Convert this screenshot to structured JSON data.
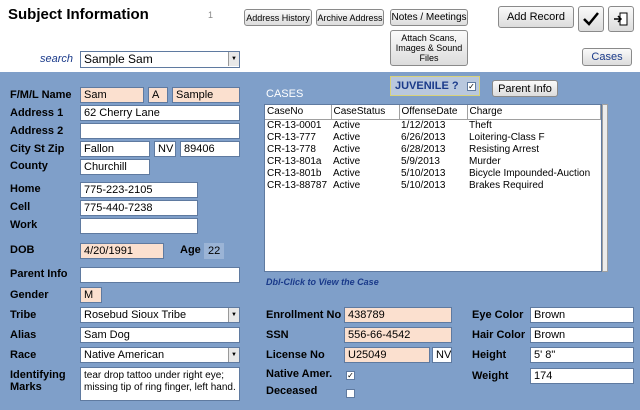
{
  "header": {
    "title": "Subject Information",
    "page_number": "1",
    "buttons": {
      "address_history": "Address History",
      "archive_address": "Archive Address",
      "notes_meetings": "Notes / Meetings",
      "add_record": "Add Record",
      "attach_files": "Attach Scans, Images & Sound Files",
      "cases": "Cases"
    },
    "search_label": "search",
    "search_value": "Sample Sam"
  },
  "subject": {
    "labels": {
      "name": "F/M/L Name",
      "address1": "Address 1",
      "address2": "Address 2",
      "city_st_zip": "City St Zip",
      "county": "County",
      "home": "Home",
      "cell": "Cell",
      "work": "Work",
      "dob": "DOB",
      "age": "Age",
      "parent_info": "Parent Info",
      "gender": "Gender",
      "tribe": "Tribe",
      "alias": "Alias",
      "race": "Race",
      "identifying_marks": "Identifying Marks"
    },
    "first_name": "Sam",
    "middle_initial": "A",
    "last_name": "Sample",
    "address1": "62 Cherry Lane",
    "address2": "",
    "city": "Fallon",
    "state": "NV",
    "zip": "89406",
    "county": "Churchill",
    "home": "775-223-2105",
    "cell": "775-440-7238",
    "work": "",
    "dob": "4/20/1991",
    "age": "22",
    "parent_info": "",
    "gender": "M",
    "tribe": "Rosebud Sioux Tribe",
    "alias": "Sam Dog",
    "race": "Native American",
    "identifying_marks": "tear drop tattoo under right eye; missing tip of ring finger, left hand."
  },
  "cases": {
    "title": "CASES",
    "juvenile_label": "JUVENILE ?",
    "juvenile_checked": true,
    "parent_info_button": "Parent Info",
    "columns": [
      "CaseNo",
      "CaseStatus",
      "OffenseDate",
      "Charge"
    ],
    "rows": [
      [
        "CR-13-0001",
        "Active",
        "1/12/2013",
        "Theft"
      ],
      [
        "CR-13-777",
        "Active",
        "6/26/2013",
        "Loitering-Class F"
      ],
      [
        "CR-13-778",
        "Active",
        "6/28/2013",
        "Resisting Arrest"
      ],
      [
        "CR-13-801a",
        "Active",
        "5/9/2013",
        "Murder"
      ],
      [
        "CR-13-801b",
        "Active",
        "5/10/2013",
        "Bicycle Impounded-Auction"
      ],
      [
        "CR-13-88787",
        "Active",
        "5/10/2013",
        "Brakes Required"
      ]
    ],
    "hint": "Dbl-Click to View the Case"
  },
  "ids": {
    "labels": {
      "enrollment": "Enrollment No",
      "ssn": "SSN",
      "license": "License No",
      "native_amer": "Native Amer.",
      "deceased": "Deceased"
    },
    "enrollment": "438789",
    "ssn": "556-66-4542",
    "license": "U25049",
    "license_state": "NV",
    "native_amer_checked": true,
    "deceased_checked": false
  },
  "physical": {
    "labels": {
      "eye_color": "Eye Color",
      "hair_color": "Hair Color",
      "height": "Height",
      "weight": "Weight"
    },
    "eye_color": "Brown",
    "hair_color": "Brown",
    "height": "5' 8\"",
    "weight": "174"
  },
  "icons": {
    "save": "checkmark-icon",
    "exit": "exit-door-icon",
    "dropdown": "triangle-down"
  }
}
